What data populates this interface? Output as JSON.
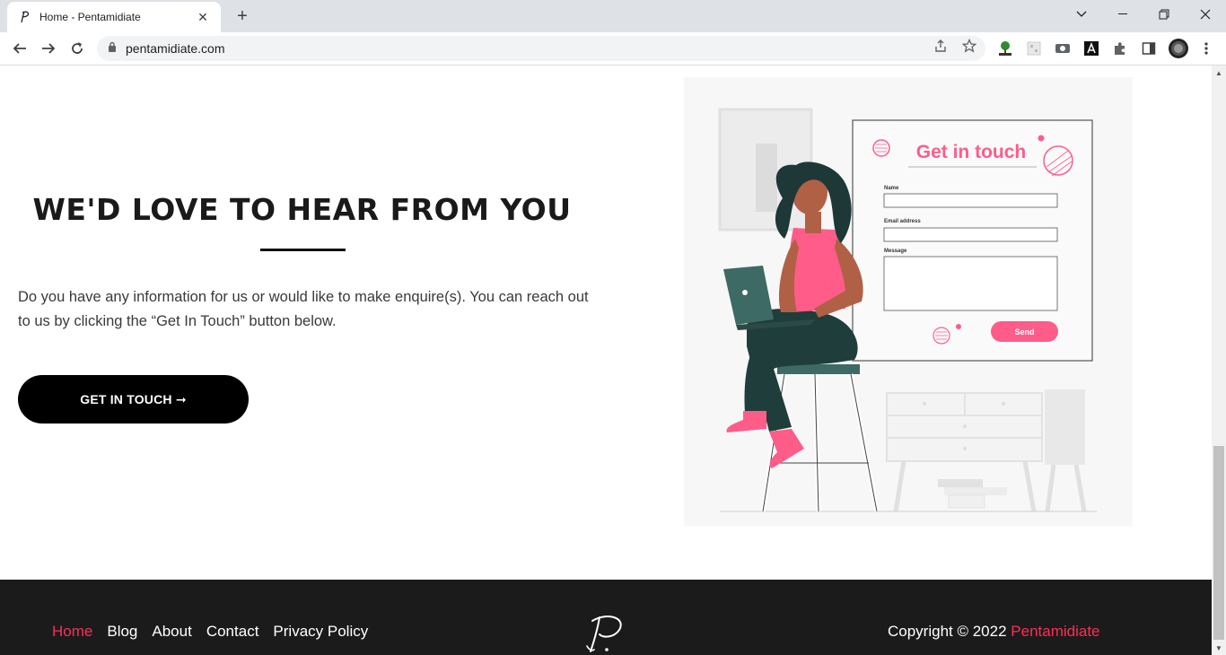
{
  "browser": {
    "tab_title": "Home - Pentamidiate",
    "url": "pentamidiate.com",
    "close_symbol": "✕",
    "new_tab_symbol": "+"
  },
  "page": {
    "hero": {
      "title": "WE'D LOVE TO HEAR FROM YOU",
      "text": "Do you have any information for us or would like to make enquire(s). You can reach out to us by clicking the “Get In Touch” button below.",
      "button_label": "GET IN TOUCH ➞"
    },
    "illustration": {
      "heading": "Get in touch",
      "field_name": "Name",
      "field_email": "Email address",
      "field_message": "Message",
      "send_label": "Send"
    },
    "footer": {
      "nav": [
        "Home",
        "Blog",
        "About",
        "Contact",
        "Privacy Policy"
      ],
      "copyright_prefix": "Copyright © 2022 ",
      "brand": "Pentamidiate"
    }
  },
  "colors": {
    "accent": "#ff2d55",
    "illustration_pink": "#ff5c8a",
    "footer_bg": "#1b1b1b"
  }
}
